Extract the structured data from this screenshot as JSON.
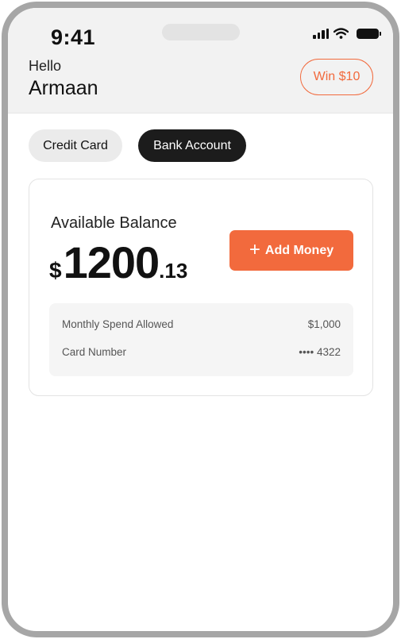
{
  "status_bar": {
    "time": "9:41",
    "icons": [
      "cellular-signal-icon",
      "wifi-icon",
      "battery-icon"
    ]
  },
  "header": {
    "greeting": "Hello",
    "user_name": "Armaan",
    "promo_label": "Win $10"
  },
  "tabs": [
    {
      "label": "Credit Card",
      "selected": false
    },
    {
      "label": "Bank Account",
      "selected": true
    }
  ],
  "balance_card": {
    "label": "Available Balance",
    "currency": "$",
    "whole": "1200",
    "cents": ".13",
    "add_button_label": "Add Money",
    "add_button_icon": "plus-icon",
    "details": [
      {
        "label": "Monthly Spend Allowed",
        "value": "$1,000"
      },
      {
        "label": "Card Number",
        "value": "•••• 4322"
      }
    ]
  },
  "colors": {
    "accent": "#f26a3d",
    "selected_tab": "#1c1c1c",
    "header_bg": "#f2f2f2",
    "frame": "#a6a6a6"
  }
}
